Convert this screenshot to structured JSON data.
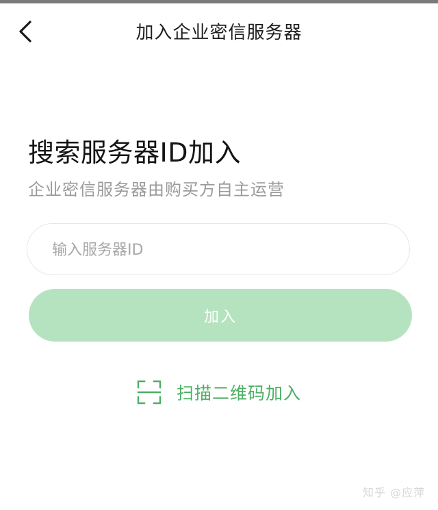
{
  "header": {
    "title": "加入企业密信服务器",
    "back_icon": "chevron-left-icon"
  },
  "main": {
    "heading": "搜索服务器ID加入",
    "subheading": "企业密信服务器由购买方自主运营",
    "search": {
      "placeholder": "输入服务器ID",
      "value": ""
    },
    "join_button_label": "加入",
    "scan": {
      "label": "扫描二维码加入",
      "icon": "qr-scan-icon"
    }
  },
  "watermark": "知乎 @应萍",
  "colors": {
    "accent": "#4caf63",
    "button_disabled": "#b6e3bf",
    "text_primary": "#141414",
    "text_secondary": "#9a9a9a",
    "input_border": "#e7e7e7"
  }
}
